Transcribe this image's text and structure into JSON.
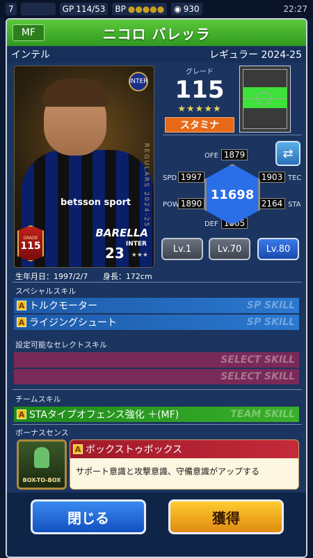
{
  "status_bar": {
    "level": "7",
    "gp_label": "GP",
    "gp_value": "114/53",
    "bp_label": "BP",
    "coins": "930",
    "time": "22:27"
  },
  "header": {
    "position": "MF",
    "player_name": "ニコロ バレッラ",
    "team": "インテル",
    "card_type": "レギュラー 2024-25"
  },
  "card": {
    "club_badge": "INTER",
    "vertical_text": "REGULARS 2024-25",
    "sponsor": "betsson sport",
    "name": "BARELLA",
    "team_label": "INTER",
    "number": "23",
    "grade_badge_label": "GRADE",
    "grade_badge_value": "115"
  },
  "grade": {
    "label": "グレード",
    "value": "115",
    "stars": "★★★★★",
    "type": "スタミナ"
  },
  "stats": {
    "ofe_label": "OFE",
    "ofe": "1879",
    "spd_label": "SPD",
    "spd": "1997",
    "tec_label": "TEC",
    "tec": "1903",
    "pow_label": "POW",
    "pow": "1890",
    "sta_label": "STA",
    "sta": "2164",
    "def_label": "DEF",
    "def": "1865",
    "total": "11698"
  },
  "levels": [
    "Lv.1",
    "Lv.70",
    "Lv.80"
  ],
  "profile": {
    "birth": "生年月日：1997/2/7",
    "height": "身長：172cm"
  },
  "special_skills": {
    "label": "スペシャルスキル",
    "items": [
      {
        "name": "トルクモーター",
        "tag": "SP SKILL"
      },
      {
        "name": "ライジングシュート",
        "tag": "SP SKILL"
      }
    ]
  },
  "select_skills": {
    "label": "設定可能なセレクトスキル",
    "items": [
      {
        "tag": "SELECT SKILL"
      },
      {
        "tag": "SELECT SKILL"
      }
    ]
  },
  "team_skill": {
    "label": "チームスキル",
    "name": "STAタイプオフェンス強化 ＋(MF)",
    "tag": "TEAM SKILL"
  },
  "bonus_sense": {
    "label": "ボーナスセンス",
    "image_text": "BOX-TO-BOX",
    "title": "ボックストゥボックス",
    "description": "サポート意識と攻撃意識、守備意識がアップする"
  },
  "buttons": {
    "close": "閉じる",
    "acquire": "獲得"
  },
  "colors": {
    "title_green": "#3fae2a",
    "stamina_orange": "#e86a18",
    "hex_blue": "#2a6ee8",
    "sp_blue": "#2a78d0",
    "select_maroon": "#7a2a58",
    "team_green": "#3ab02a"
  }
}
